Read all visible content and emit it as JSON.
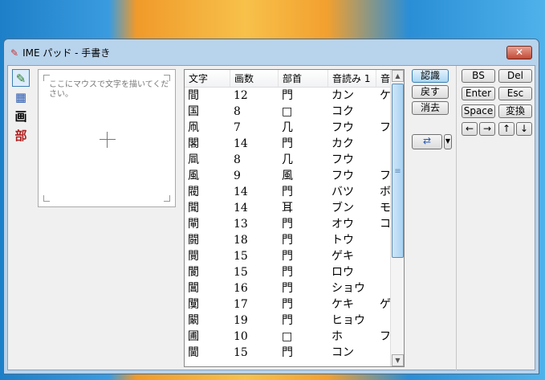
{
  "window": {
    "title": "IME パッド - 手書き",
    "close": "✕"
  },
  "left_tools": [
    {
      "icon": "pencil-icon",
      "glyph": "✎"
    },
    {
      "icon": "softkeyboard-icon",
      "glyph": "▦"
    },
    {
      "icon": "stroke-count-icon",
      "glyph": "画"
    },
    {
      "icon": "radical-icon",
      "glyph": "部"
    }
  ],
  "pad": {
    "hint": "ここにマウスで文字を描いてください。"
  },
  "list": {
    "headers": [
      "文字",
      "画数",
      "部首",
      "音読み 1",
      "音"
    ],
    "rows": [
      [
        "間",
        "12",
        "門",
        "カン",
        "ケ"
      ],
      [
        "国",
        "8",
        "□",
        "コク",
        ""
      ],
      [
        "凧",
        "7",
        "几",
        "フウ",
        "フ"
      ],
      [
        "閣",
        "14",
        "門",
        "カク",
        ""
      ],
      [
        "凬",
        "8",
        "几",
        "フウ",
        ""
      ],
      [
        "風",
        "9",
        "風",
        "フウ",
        "フ"
      ],
      [
        "閥",
        "14",
        "門",
        "バツ",
        "ボ"
      ],
      [
        "聞",
        "14",
        "耳",
        "ブン",
        "モ"
      ],
      [
        "閘",
        "13",
        "門",
        "オウ",
        "コ"
      ],
      [
        "闘",
        "18",
        "門",
        "トウ",
        ""
      ],
      [
        "閴",
        "15",
        "門",
        "ゲキ",
        ""
      ],
      [
        "閬",
        "15",
        "門",
        "ロウ",
        ""
      ],
      [
        "閶",
        "16",
        "門",
        "ショウ",
        ""
      ],
      [
        "闃",
        "17",
        "門",
        "ケキ",
        "ゲ"
      ],
      [
        "闞",
        "19",
        "門",
        "ヒョウ",
        ""
      ],
      [
        "圃",
        "10",
        "□",
        "ホ",
        "フ"
      ],
      [
        "閫",
        "15",
        "門",
        "コン",
        ""
      ]
    ]
  },
  "buttons": {
    "recognize": "認識",
    "back": "戻す",
    "clear": "消去"
  },
  "keys": {
    "bs": "BS",
    "del": "Del",
    "enter": "Enter",
    "esc": "Esc",
    "space": "Space",
    "convert": "変換",
    "left": "←",
    "right": "→",
    "up": "↑",
    "down": "↓"
  }
}
